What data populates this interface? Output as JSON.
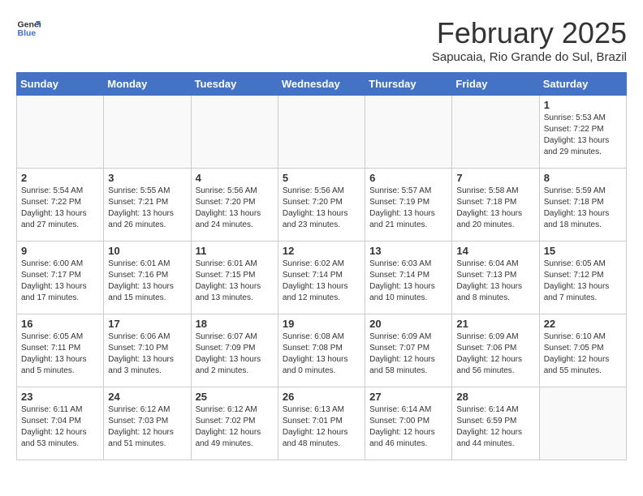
{
  "header": {
    "logo_line1": "General",
    "logo_line2": "Blue",
    "month": "February 2025",
    "location": "Sapucaia, Rio Grande do Sul, Brazil"
  },
  "days_of_week": [
    "Sunday",
    "Monday",
    "Tuesday",
    "Wednesday",
    "Thursday",
    "Friday",
    "Saturday"
  ],
  "weeks": [
    [
      {
        "day": "",
        "info": ""
      },
      {
        "day": "",
        "info": ""
      },
      {
        "day": "",
        "info": ""
      },
      {
        "day": "",
        "info": ""
      },
      {
        "day": "",
        "info": ""
      },
      {
        "day": "",
        "info": ""
      },
      {
        "day": "1",
        "info": "Sunrise: 5:53 AM\nSunset: 7:22 PM\nDaylight: 13 hours\nand 29 minutes."
      }
    ],
    [
      {
        "day": "2",
        "info": "Sunrise: 5:54 AM\nSunset: 7:22 PM\nDaylight: 13 hours\nand 27 minutes."
      },
      {
        "day": "3",
        "info": "Sunrise: 5:55 AM\nSunset: 7:21 PM\nDaylight: 13 hours\nand 26 minutes."
      },
      {
        "day": "4",
        "info": "Sunrise: 5:56 AM\nSunset: 7:20 PM\nDaylight: 13 hours\nand 24 minutes."
      },
      {
        "day": "5",
        "info": "Sunrise: 5:56 AM\nSunset: 7:20 PM\nDaylight: 13 hours\nand 23 minutes."
      },
      {
        "day": "6",
        "info": "Sunrise: 5:57 AM\nSunset: 7:19 PM\nDaylight: 13 hours\nand 21 minutes."
      },
      {
        "day": "7",
        "info": "Sunrise: 5:58 AM\nSunset: 7:18 PM\nDaylight: 13 hours\nand 20 minutes."
      },
      {
        "day": "8",
        "info": "Sunrise: 5:59 AM\nSunset: 7:18 PM\nDaylight: 13 hours\nand 18 minutes."
      }
    ],
    [
      {
        "day": "9",
        "info": "Sunrise: 6:00 AM\nSunset: 7:17 PM\nDaylight: 13 hours\nand 17 minutes."
      },
      {
        "day": "10",
        "info": "Sunrise: 6:01 AM\nSunset: 7:16 PM\nDaylight: 13 hours\nand 15 minutes."
      },
      {
        "day": "11",
        "info": "Sunrise: 6:01 AM\nSunset: 7:15 PM\nDaylight: 13 hours\nand 13 minutes."
      },
      {
        "day": "12",
        "info": "Sunrise: 6:02 AM\nSunset: 7:14 PM\nDaylight: 13 hours\nand 12 minutes."
      },
      {
        "day": "13",
        "info": "Sunrise: 6:03 AM\nSunset: 7:14 PM\nDaylight: 13 hours\nand 10 minutes."
      },
      {
        "day": "14",
        "info": "Sunrise: 6:04 AM\nSunset: 7:13 PM\nDaylight: 13 hours\nand 8 minutes."
      },
      {
        "day": "15",
        "info": "Sunrise: 6:05 AM\nSunset: 7:12 PM\nDaylight: 13 hours\nand 7 minutes."
      }
    ],
    [
      {
        "day": "16",
        "info": "Sunrise: 6:05 AM\nSunset: 7:11 PM\nDaylight: 13 hours\nand 5 minutes."
      },
      {
        "day": "17",
        "info": "Sunrise: 6:06 AM\nSunset: 7:10 PM\nDaylight: 13 hours\nand 3 minutes."
      },
      {
        "day": "18",
        "info": "Sunrise: 6:07 AM\nSunset: 7:09 PM\nDaylight: 13 hours\nand 2 minutes."
      },
      {
        "day": "19",
        "info": "Sunrise: 6:08 AM\nSunset: 7:08 PM\nDaylight: 13 hours\nand 0 minutes."
      },
      {
        "day": "20",
        "info": "Sunrise: 6:09 AM\nSunset: 7:07 PM\nDaylight: 12 hours\nand 58 minutes."
      },
      {
        "day": "21",
        "info": "Sunrise: 6:09 AM\nSunset: 7:06 PM\nDaylight: 12 hours\nand 56 minutes."
      },
      {
        "day": "22",
        "info": "Sunrise: 6:10 AM\nSunset: 7:05 PM\nDaylight: 12 hours\nand 55 minutes."
      }
    ],
    [
      {
        "day": "23",
        "info": "Sunrise: 6:11 AM\nSunset: 7:04 PM\nDaylight: 12 hours\nand 53 minutes."
      },
      {
        "day": "24",
        "info": "Sunrise: 6:12 AM\nSunset: 7:03 PM\nDaylight: 12 hours\nand 51 minutes."
      },
      {
        "day": "25",
        "info": "Sunrise: 6:12 AM\nSunset: 7:02 PM\nDaylight: 12 hours\nand 49 minutes."
      },
      {
        "day": "26",
        "info": "Sunrise: 6:13 AM\nSunset: 7:01 PM\nDaylight: 12 hours\nand 48 minutes."
      },
      {
        "day": "27",
        "info": "Sunrise: 6:14 AM\nSunset: 7:00 PM\nDaylight: 12 hours\nand 46 minutes."
      },
      {
        "day": "28",
        "info": "Sunrise: 6:14 AM\nSunset: 6:59 PM\nDaylight: 12 hours\nand 44 minutes."
      },
      {
        "day": "",
        "info": ""
      }
    ]
  ]
}
